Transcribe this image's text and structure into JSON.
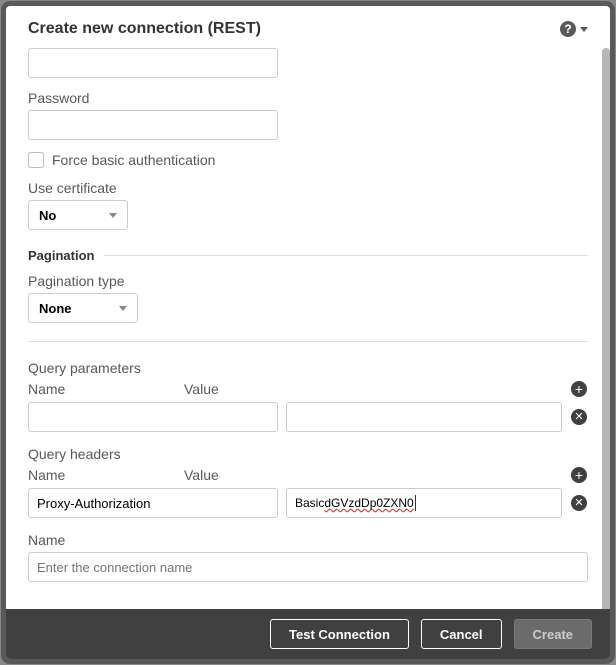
{
  "dialog": {
    "title": "Create new connection (REST)"
  },
  "fields": {
    "password_label": "Password",
    "password_value": "",
    "force_basic_label": "Force basic authentication",
    "force_basic_checked": false,
    "use_cert_label": "Use certificate",
    "use_cert_value": "No"
  },
  "pagination": {
    "section_title": "Pagination",
    "type_label": "Pagination type",
    "type_value": "None"
  },
  "query_params": {
    "section_label": "Query parameters",
    "name_col": "Name",
    "value_col": "Value",
    "rows": [
      {
        "name": "",
        "value": ""
      }
    ]
  },
  "query_headers": {
    "section_label": "Query headers",
    "name_col": "Name",
    "value_col": "Value",
    "rows": [
      {
        "name": "Proxy-Authorization",
        "value_prefix": "Basic ",
        "value_underlined": "dGVzdDp0ZXN0"
      }
    ]
  },
  "conn_name": {
    "label": "Name",
    "placeholder": "Enter the connection name",
    "value": ""
  },
  "footer": {
    "test": "Test Connection",
    "cancel": "Cancel",
    "create": "Create"
  }
}
